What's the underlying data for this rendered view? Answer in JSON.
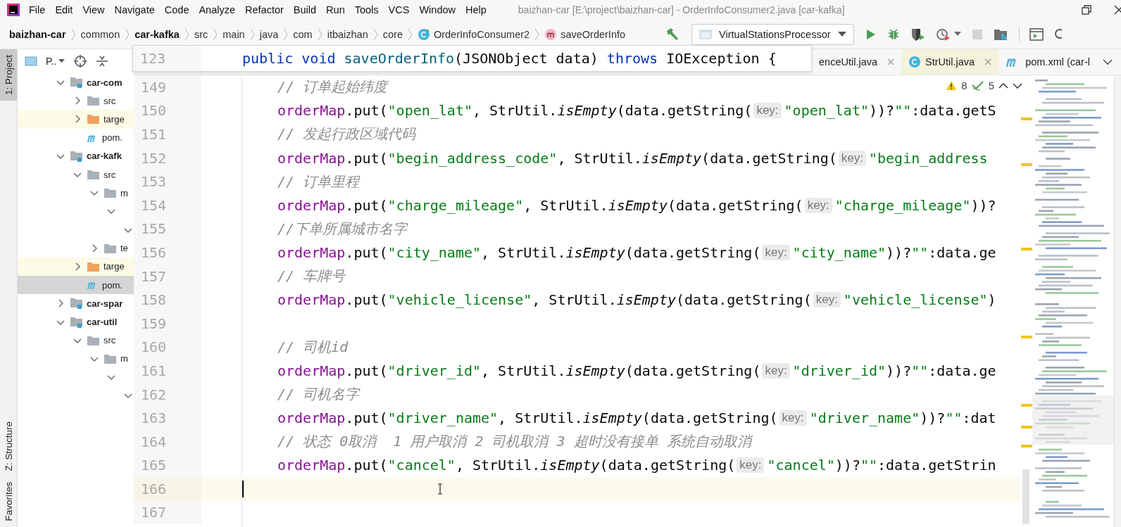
{
  "title_bar": {
    "menus": [
      "File",
      "Edit",
      "View",
      "Navigate",
      "Code",
      "Analyze",
      "Refactor",
      "Build",
      "Run",
      "Tools",
      "VCS",
      "Window",
      "Help"
    ],
    "title": "baizhan-car [E:\\project\\baizhan-car] - OrderInfoConsumer2.java [car-kafka]"
  },
  "nav_bar": {
    "crumbs": [
      {
        "label": "baizhan-car",
        "bold": true,
        "kind": "plain"
      },
      {
        "label": "common",
        "bold": false,
        "kind": "plain"
      },
      {
        "label": "car-kafka",
        "bold": true,
        "kind": "plain"
      },
      {
        "label": "src",
        "bold": false,
        "kind": "plain"
      },
      {
        "label": "main",
        "bold": false,
        "kind": "plain"
      },
      {
        "label": "java",
        "bold": false,
        "kind": "plain"
      },
      {
        "label": "com",
        "bold": false,
        "kind": "plain"
      },
      {
        "label": "itbaizhan",
        "bold": false,
        "kind": "plain"
      },
      {
        "label": "core",
        "bold": false,
        "kind": "plain"
      },
      {
        "label": "OrderInfoConsumer2",
        "bold": false,
        "kind": "class"
      },
      {
        "label": "saveOrderInfo",
        "bold": false,
        "kind": "method"
      }
    ],
    "run_config": "VirtualStationsProcessor",
    "stop_disabled": true
  },
  "tool_windows_top": [
    {
      "label": "1: Project",
      "selected": true
    }
  ],
  "tool_windows_bottom": [
    {
      "label": "Z: Structure",
      "selected": false
    },
    {
      "label": "Favorites",
      "selected": false
    }
  ],
  "project": {
    "title": "P..",
    "tree": [
      {
        "label": "car-com",
        "kind": "module",
        "expanded": true,
        "selected": false,
        "children": [
          {
            "label": "src",
            "kind": "folder",
            "expanded": false,
            "selected": false
          },
          {
            "label": "targe",
            "kind": "excluded",
            "expanded": false,
            "selected": false
          },
          {
            "label": "pom.",
            "kind": "maven",
            "selected": false
          }
        ]
      },
      {
        "label": "car-kafk",
        "kind": "module",
        "expanded": true,
        "selected": false,
        "children": [
          {
            "label": "src",
            "kind": "folder",
            "expanded": true,
            "selected": false,
            "children": [
              {
                "label": "m",
                "kind": "folder",
                "expanded": true,
                "selected": false,
                "children": [
                  {
                    "expanded": true,
                    "selected": false,
                    "children": [
                      {
                        "expanded": true,
                        "selected": false
                      }
                    ]
                  }
                ]
              },
              {
                "label": "te",
                "kind": "folder",
                "expanded": false,
                "selected": false
              }
            ]
          },
          {
            "label": "targe",
            "kind": "excluded",
            "expanded": false,
            "selected": false
          },
          {
            "label": "pom.",
            "kind": "maven",
            "selected": true
          }
        ]
      },
      {
        "label": "car-spar",
        "kind": "module",
        "expanded": false,
        "selected": false
      },
      {
        "label": "car-util",
        "kind": "module",
        "expanded": true,
        "selected": false,
        "children": [
          {
            "label": "src",
            "kind": "folder",
            "expanded": true,
            "selected": false,
            "children": [
              {
                "label": "m",
                "kind": "folder",
                "expanded": true,
                "selected": false,
                "children": [
                  {
                    "expanded": true,
                    "selected": false,
                    "children": [
                      {
                        "expanded": true,
                        "selected": false
                      }
                    ]
                  }
                ]
              }
            ]
          }
        ]
      }
    ]
  },
  "tabs": [
    {
      "label": "enceUtil.java",
      "kind": "plain",
      "closable": true,
      "color": "#f7f7f7"
    },
    {
      "label": "StrUtil.java",
      "kind": "class",
      "closable": true,
      "color": "#f4f2dc"
    },
    {
      "label": "pom.xml (car-l",
      "kind": "maven",
      "closable": false,
      "color": "#f7f7f7"
    }
  ],
  "sticky_header": {
    "line": "123",
    "code": "public void saveOrderInfo(JSONObject data) throws IOException {"
  },
  "inspections": {
    "warnings": "8",
    "weak_warnings": "5"
  },
  "lines": [
    {
      "no": "149",
      "current": false,
      "code": "// 订单起始纬度"
    },
    {
      "no": "150",
      "current": false,
      "code": "orderMap.put(\"open_lat\", StrUtil.isEmpty(data.getString(",
      "hint": "key:",
      "rest": "\"open_lat\"))?\"\":data.getS"
    },
    {
      "no": "151",
      "current": false,
      "code": "// 发起行政区域代码"
    },
    {
      "no": "152",
      "current": false,
      "code": "orderMap.put(\"begin_address_code\", StrUtil.isEmpty(data.getString(",
      "hint": "key:",
      "rest": "\"begin_address"
    },
    {
      "no": "153",
      "current": false,
      "code": "// 订单里程"
    },
    {
      "no": "154",
      "current": false,
      "code": "orderMap.put(\"charge_mileage\", StrUtil.isEmpty(data.getString(",
      "hint": "key:",
      "rest": "\"charge_mileage\"))?"
    },
    {
      "no": "155",
      "current": false,
      "code": "//下单所属城市名字"
    },
    {
      "no": "156",
      "current": false,
      "code": "orderMap.put(\"city_name\", StrUtil.isEmpty(data.getString(",
      "hint": "key:",
      "rest": "\"city_name\"))?\"\":data.ge"
    },
    {
      "no": "157",
      "current": false,
      "code": "// 车牌号"
    },
    {
      "no": "158",
      "current": false,
      "code": "orderMap.put(\"vehicle_license\", StrUtil.isEmpty(data.getString(",
      "hint": "key:",
      "rest": "\"vehicle_license\")"
    },
    {
      "no": "159",
      "current": false
    },
    {
      "no": "160",
      "current": false,
      "code": "// 司机id"
    },
    {
      "no": "161",
      "current": false,
      "code": "orderMap.put(\"driver_id\", StrUtil.isEmpty(data.getString(",
      "hint": "key:",
      "rest": "\"driver_id\"))?\"\":data.ge"
    },
    {
      "no": "162",
      "current": false,
      "code": "// 司机名字"
    },
    {
      "no": "163",
      "current": false,
      "code": "orderMap.put(\"driver_name\", StrUtil.isEmpty(data.getString(",
      "hint": "key:",
      "rest": "\"driver_name\"))?\"\":dat"
    },
    {
      "no": "164",
      "current": false,
      "code": "// 状态 0取消  1 用户取消 2 司机取消 3 超时没有接单 系统自动取消"
    },
    {
      "no": "165",
      "current": false,
      "code": "orderMap.put(\"cancel\", StrUtil.isEmpty(data.getString(",
      "hint": "key:",
      "rest": "\"cancel\"))?\"\":data.getStrin"
    },
    {
      "no": "166",
      "current": true
    },
    {
      "no": "167",
      "current": false
    }
  ]
}
